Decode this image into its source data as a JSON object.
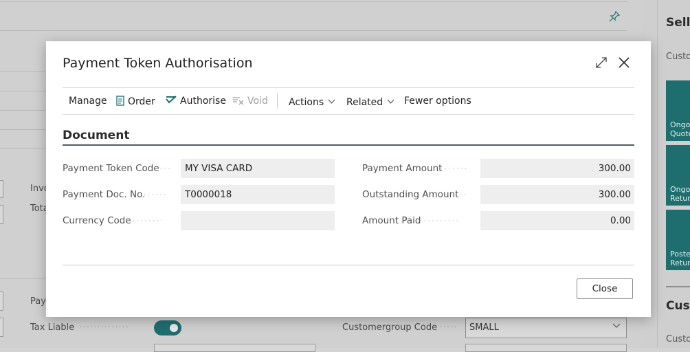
{
  "dialog": {
    "title": "Payment Token Authorisation",
    "actions": {
      "manage": "Manage",
      "order": "Order",
      "authorise": "Authorise",
      "void": "Void",
      "actions": "Actions",
      "related": "Related",
      "fewer_options": "Fewer options"
    },
    "section_title": "Document",
    "fields_left": [
      {
        "label": "Payment Token Code",
        "value": "MY VISA CARD"
      },
      {
        "label": "Payment Doc. No.",
        "value": "T0000018"
      },
      {
        "label": "Currency Code",
        "value": ""
      }
    ],
    "fields_right": [
      {
        "label": "Payment Amount",
        "value": "300.00"
      },
      {
        "label": "Outstanding Amount",
        "value": "300.00"
      },
      {
        "label": "Amount Paid",
        "value": "0.00"
      }
    ],
    "close_label": "Close"
  },
  "background": {
    "factbox_heading": "Sell-",
    "factbox_sub": "Custo",
    "tiles": [
      "Ongo\nQuote",
      "Ongo\nRetur",
      "Poste\nRetur"
    ],
    "factbox_heading2": "Cust",
    "factbox_sub2": "Custo",
    "labels": {
      "inv": "Invo",
      "tot": "Tota",
      "pay": "Pay",
      "tax_liable": "Tax Liable",
      "customergroup_code": "Customergroup Code"
    },
    "customergroup_value": "SMALL",
    "tax_liable_on": true
  },
  "colors": {
    "accent": "#1f6e6f",
    "section_rule": "#505c5e",
    "field_bg": "#eeeeef"
  }
}
